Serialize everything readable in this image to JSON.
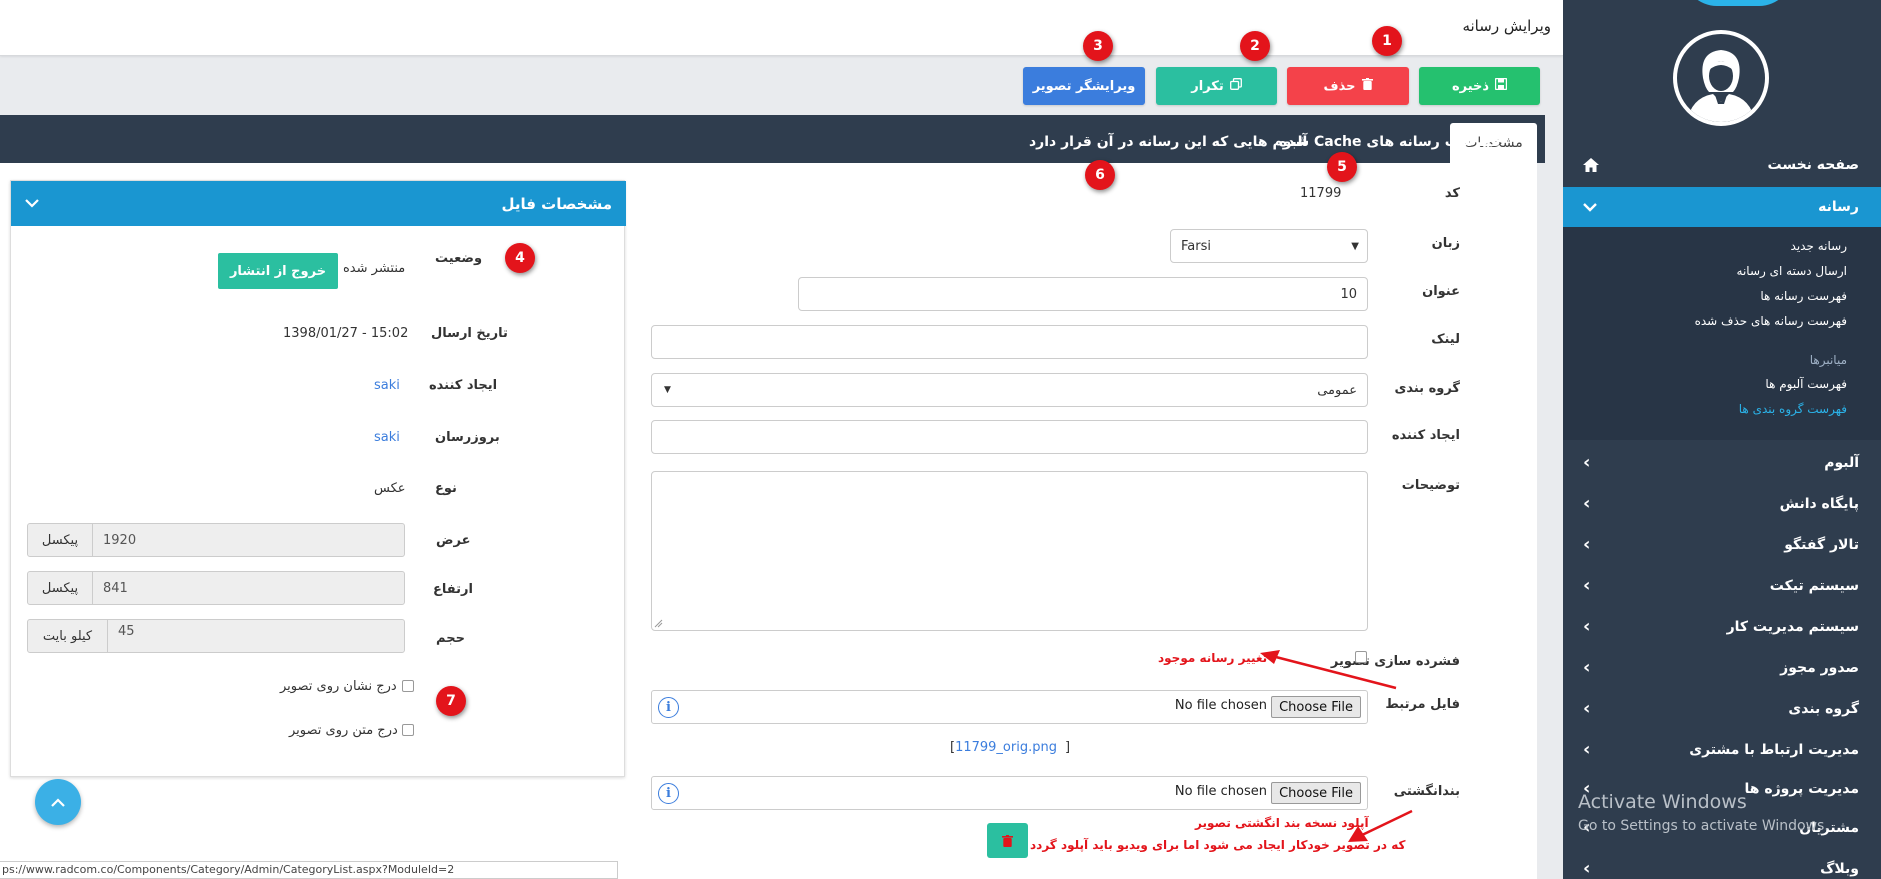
{
  "header": {
    "title": "ویرایش رسانه"
  },
  "toolbar": {
    "save_label": "ذخیره",
    "delete_label": "حذف",
    "repeat_label": "تکرار",
    "editor_label": "ویرایشگر تصویر"
  },
  "badges": [
    "1",
    "2",
    "3",
    "4",
    "5",
    "6",
    "7"
  ],
  "tabs": {
    "specs": "مشخصات",
    "cache": "فهرست رسانه های Cache شده",
    "albums": "آلبوم هایی که این رسانه در آن قرار دارد"
  },
  "form": {
    "code_label": "کد",
    "code_value": "11799",
    "language_label": "زبان",
    "language_value": "Farsi",
    "title_label": "عنوان",
    "title_value": "10",
    "link_label": "لینک",
    "category_label": "گروه بندی",
    "category_value": "عمومی",
    "creator_label": "ایجاد کننده",
    "description_label": "توضیحات",
    "compress_label": "فشرده سازی تصویر",
    "related_file_label": "فایل مرتبط",
    "fingerprint_label": "بندانگشتی",
    "choose_file": "Choose File",
    "no_file": "No file chosen",
    "file_link": "11799_orig.png",
    "bracket": "]"
  },
  "annotations": {
    "change_media": "تغییر رسانه موجود",
    "thumb_line1": "آپلود نسخه بند انگشتی تصویر",
    "thumb_line2": "که در تصویر خودکار ایجاد می شود اما برای ویدیو باید آپلود گردد"
  },
  "card": {
    "title": "مشخصات فایل",
    "status_label": "وضعیت",
    "status_value": "منتشر شده",
    "unpublish_button": "خروج از انتشار",
    "send_date_label": "تاریخ ارسال",
    "send_date_value": "1398/01/27 - 15:02",
    "creator_label": "ایجاد کننده",
    "creator_value": "saki",
    "updater_label": "بروزرسان",
    "updater_value": "saki",
    "type_label": "نوع",
    "type_value": "عکس",
    "width_label": "عرض",
    "width_value": "1920",
    "height_label": "ارتفاع",
    "height_value": "841",
    "size_label": "حجم",
    "size_value": "45",
    "unit_pixel": "پیکسل",
    "unit_kb": "کیلو بایت",
    "watermark_label": "درج نشان روی تصویر",
    "text_label": "درج متن روی تصویر"
  },
  "status_url": "ps://www.radcom.co/Components/Category/Admin/CategoryList.aspx?ModuleId=2",
  "sidebar": {
    "home": "صفحه نخست",
    "media": "رسانه",
    "sub": [
      "رسانه جدید",
      "ارسال دسته ای رسانه",
      "فهرست رسانه ها",
      "فهرست رسانه های حذف شده"
    ],
    "shortcuts": "میانبرها",
    "sub2": [
      "فهرست آلبوم ها",
      "فهرست گروه بندی ها"
    ],
    "items": [
      "آلبوم",
      "پایگاه دانش",
      "تالار گفتگو",
      "سیستم تیکت",
      "سیستم مدیریت کار",
      "صدور مجوز",
      "گروه بندی",
      "مدیریت ارتباط با مشتری",
      "مدیریت پروژه ها",
      "مشتریان",
      "وبلاگ"
    ]
  },
  "watermark": {
    "line1": "Activate Windows",
    "line2": "Go to Settings to activate Windows."
  },
  "colors": {
    "save": "#25c16f",
    "delete": "#f4424a",
    "repeat": "#2bbfa0",
    "editor": "#3b7ddd",
    "sidebar": "#2f3d4e",
    "card_header": "#1a96d1",
    "badge": "#e3141b"
  }
}
